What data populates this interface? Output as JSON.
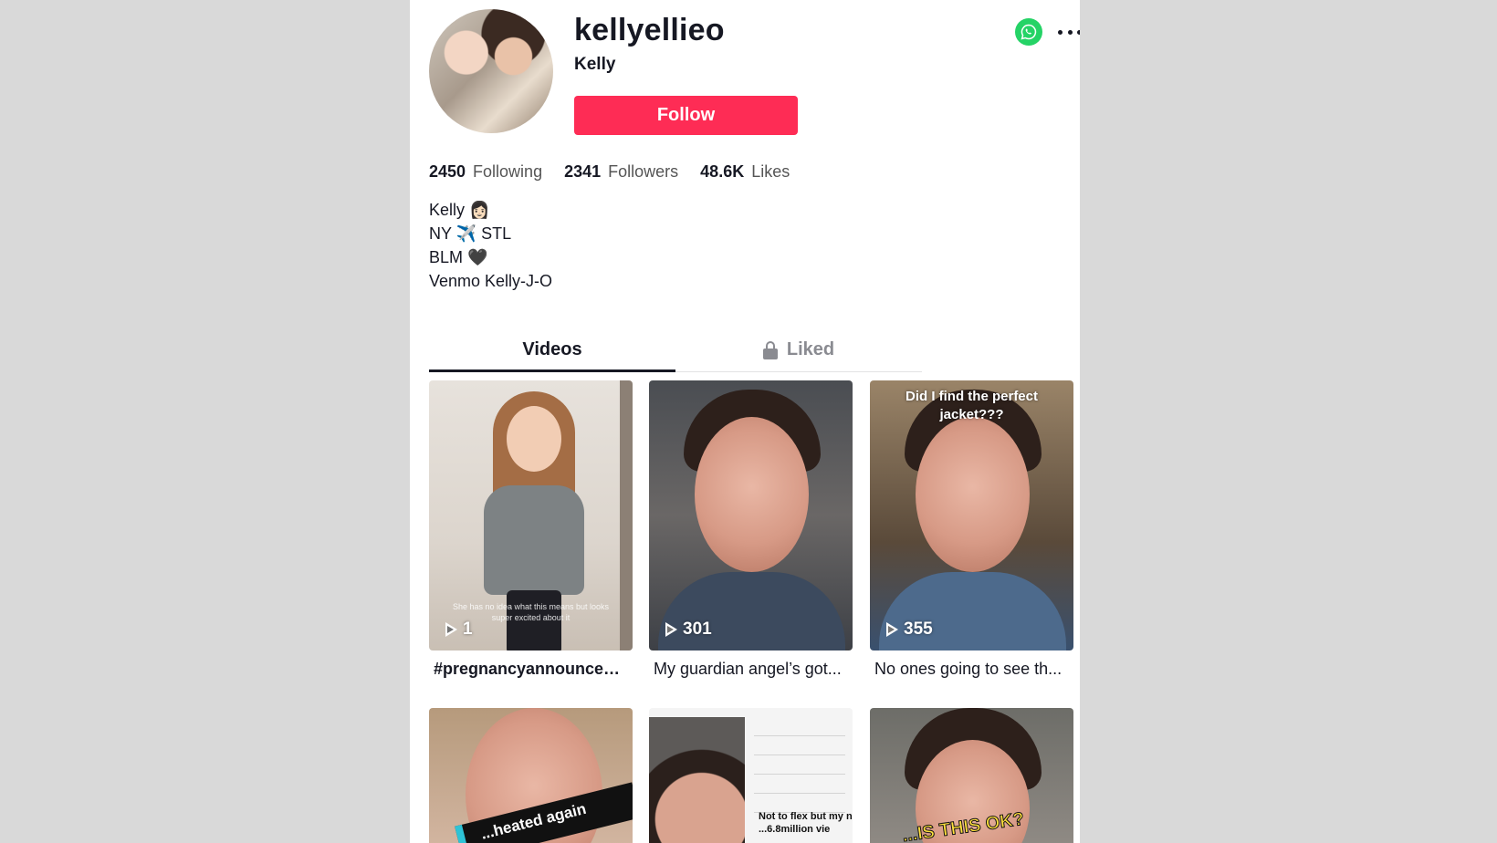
{
  "profile": {
    "username": "kellyellieo",
    "nickname": "Kelly",
    "follow_label": "Follow",
    "share_icon": "whatsapp-icon",
    "more_icon": "more-dots-icon"
  },
  "stats": [
    {
      "number": "2450",
      "label": "Following"
    },
    {
      "number": "2341",
      "label": "Followers"
    },
    {
      "number": "48.6K",
      "label": "Likes"
    }
  ],
  "bio": {
    "line1": "Kelly 👩🏻",
    "line2": "NY ✈️ STL",
    "line3": "BLM 🖤",
    "line4": "Venmo Kelly-J-O"
  },
  "tabs": {
    "videos": "Videos",
    "liked": "Liked"
  },
  "videos": [
    {
      "views": "1",
      "caption": "#pregnancyannouncem...",
      "overlay": "She has no idea what this means but looks super excited about it"
    },
    {
      "views": "301",
      "caption": "My guardian angel’s got..."
    },
    {
      "views": "355",
      "caption": "No ones going to see th...",
      "overlay": "Did I find the perfect jacket???"
    },
    {
      "overlay": "...heated again"
    },
    {
      "overlay": "Not to flex but my n ...6.8million vie"
    },
    {
      "overlay": "...IS THIS OK?"
    }
  ],
  "colors": {
    "follow_button": "#fe2c55",
    "whatsapp": "#25d366",
    "background": "#d9d9d9"
  }
}
